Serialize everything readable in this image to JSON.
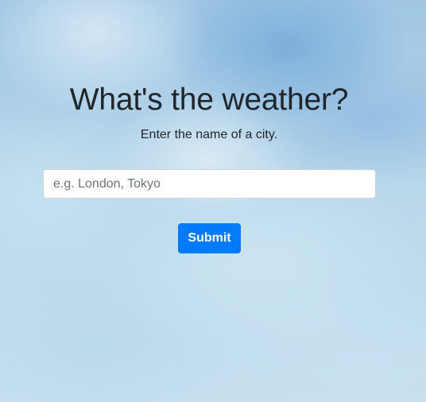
{
  "page": {
    "title": "What's the weather?",
    "subtitle": "Enter the name of a city."
  },
  "search": {
    "value": "",
    "placeholder": "e.g. London, Tokyo"
  },
  "actions": {
    "submit_label": "Submit"
  },
  "colors": {
    "accent": "#007bff",
    "text": "#212529",
    "background": "#a9cde6"
  }
}
